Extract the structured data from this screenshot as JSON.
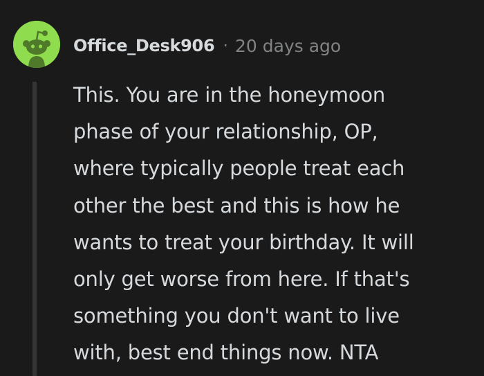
{
  "comment": {
    "author": "Office_Desk906",
    "separator": "·",
    "timestamp": "20 days ago",
    "avatar_icon": "snoo-avatar-icon",
    "avatar_color": "#8fdc4f",
    "body_lines": [
      "This. You are in the honeymoon",
      "phase of your relationship, OP,",
      "where typically people treat each",
      "other the best and this is how he",
      "wants to treat your birthday. It will",
      "only get worse from here. If that's",
      "something you don't want to live",
      "with, best end things now. NTA"
    ]
  },
  "colors": {
    "background": "#1a1a1b",
    "text": "#d7dadc",
    "muted": "#818384",
    "thread_line": "#343536"
  }
}
